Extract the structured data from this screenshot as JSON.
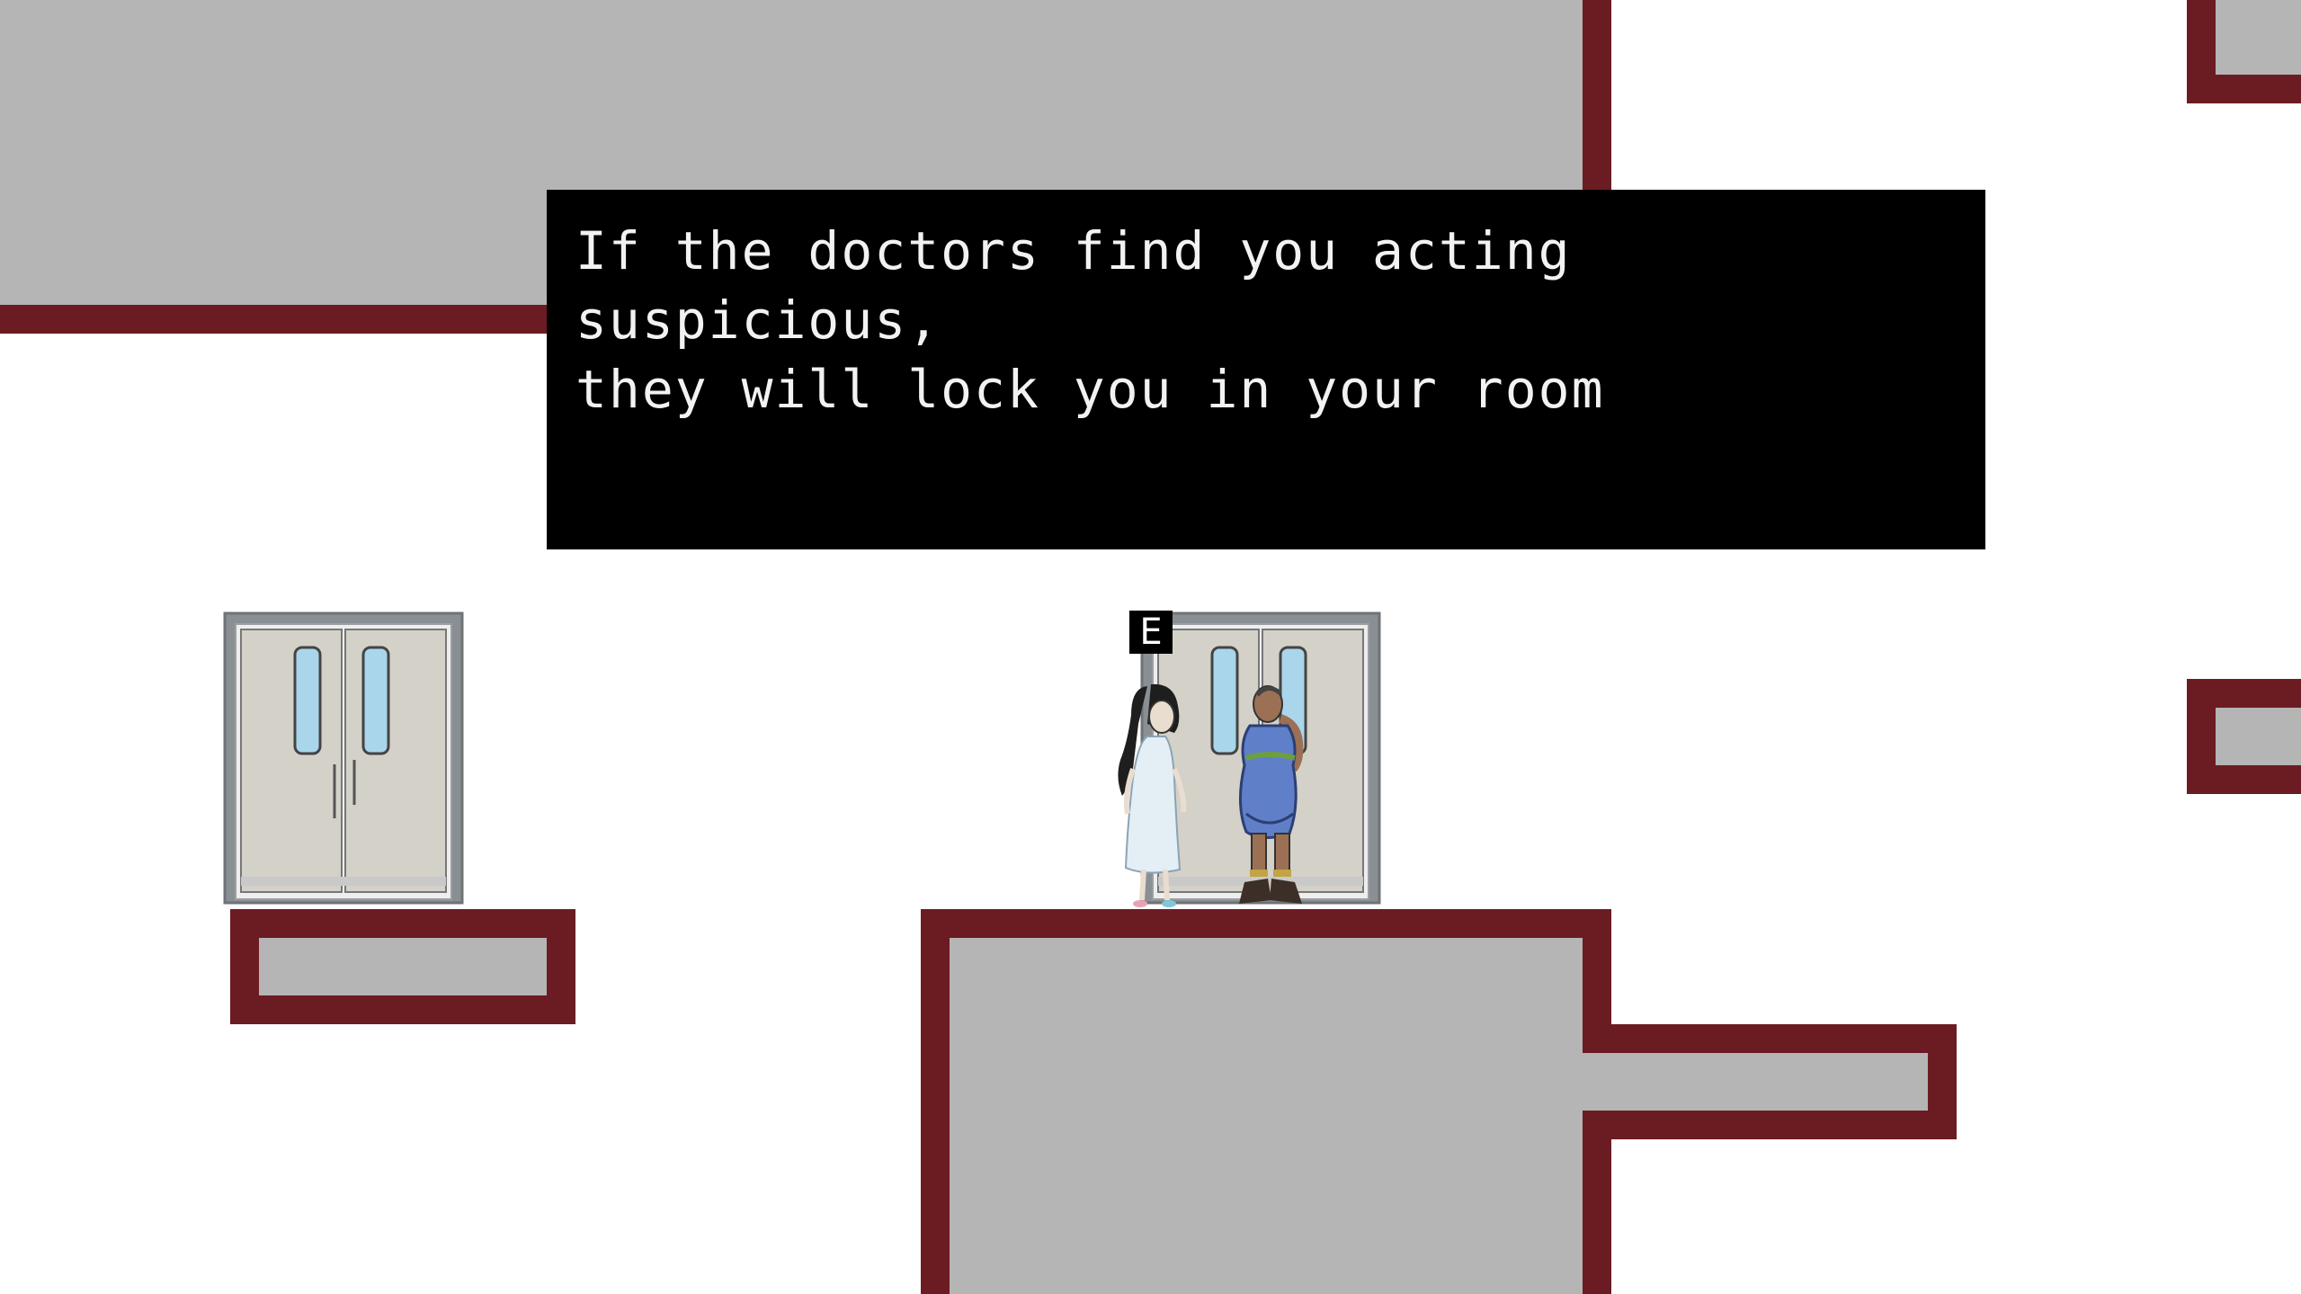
{
  "dialog": {
    "text": "If the doctors find you acting suspicious,\nthey will lock you in your room"
  },
  "interaction_prompt": {
    "key": "E"
  },
  "colors": {
    "floor_fill": "#b5b5b5",
    "floor_trim": "#6b1c22",
    "background": "#ffffff",
    "dialog_background": "#000000",
    "dialog_text": "#f2f2f2",
    "door_frame": "#8a8f93",
    "door_panel": "#d3d1c8",
    "door_window": "#a9d6ea",
    "patient_gown": "#e4eef5",
    "doctor_outfit": "#5f7fc9"
  },
  "scene": {
    "icons": [
      "double-door-icon",
      "double-door-icon",
      "patient-character-icon",
      "doctor-character-icon"
    ]
  }
}
